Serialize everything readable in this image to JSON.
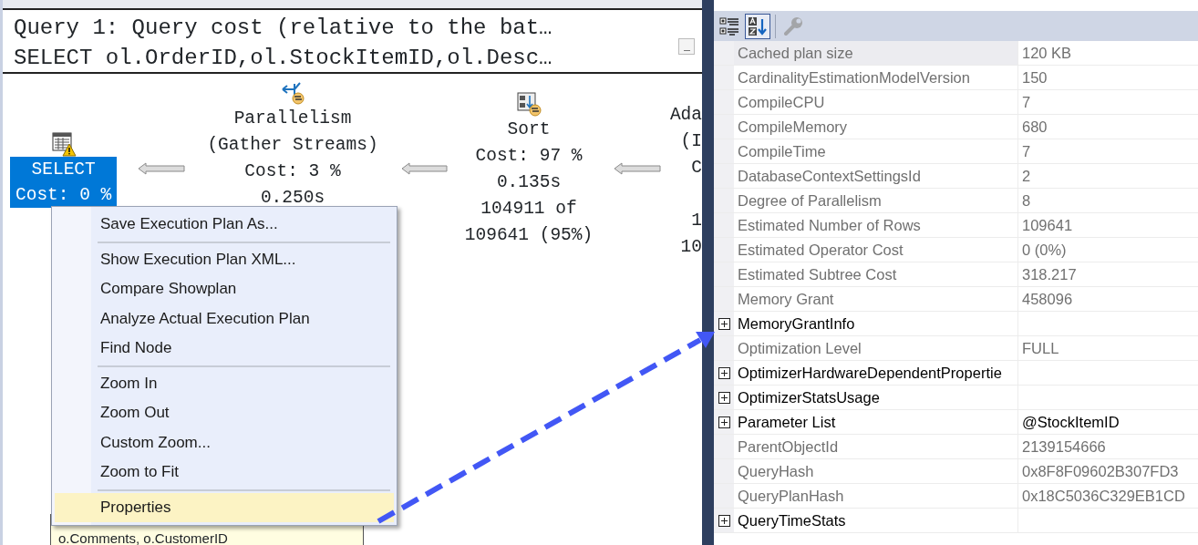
{
  "header": {
    "lines": [
      "Query 1: Query cost (relative to the bat…",
      "SELECT ol.OrderID,ol.StockItemID,ol.Desc…"
    ]
  },
  "plan": {
    "nodes": [
      {
        "kind": "select",
        "lines": [
          "SELECT",
          "Cost: 0 %"
        ],
        "selected": true,
        "warning": true
      },
      {
        "kind": "parallelism",
        "lines": [
          "Parallelism",
          "(Gather Streams)",
          "Cost: 3 %",
          "0.250s"
        ],
        "selected": false,
        "warning": false
      },
      {
        "kind": "sort",
        "lines": [
          "Sort",
          "Cost: 97 %",
          "0.135s",
          "104911 of",
          "109641 (95%)"
        ],
        "selected": false,
        "warning": false
      },
      {
        "kind": "partial",
        "lines": [
          "Ada",
          "(I",
          "C"
        ],
        "lower_lines": [
          "1",
          "10"
        ],
        "selected": false
      }
    ]
  },
  "tooltip": {
    "text": "o.Comments, o.CustomerID"
  },
  "context_menu": {
    "groups": [
      [
        {
          "label": "Save Execution Plan As...",
          "selected": false
        }
      ],
      [
        {
          "label": "Show Execution Plan XML...",
          "selected": false
        },
        {
          "label": "Compare Showplan",
          "selected": false
        },
        {
          "label": "Analyze Actual Execution Plan",
          "selected": false
        },
        {
          "label": "Find Node",
          "selected": false
        }
      ],
      [
        {
          "label": "Zoom In",
          "selected": false
        },
        {
          "label": "Zoom Out",
          "selected": false
        },
        {
          "label": "Custom Zoom...",
          "selected": false
        },
        {
          "label": "Zoom to Fit",
          "selected": false
        }
      ],
      [
        {
          "label": "Properties",
          "selected": true
        }
      ]
    ]
  },
  "properties": {
    "toolbar": [
      {
        "kind": "categorized",
        "selected": false,
        "disabled": false
      },
      {
        "kind": "alphabetical",
        "selected": true,
        "disabled": false
      },
      {
        "kind": "property-pages",
        "selected": false,
        "disabled": true
      }
    ],
    "rows": [
      {
        "kind": "value",
        "name": "Cached plan size",
        "value": "120 KB",
        "selected": true
      },
      {
        "kind": "value",
        "name": "CardinalityEstimationModelVersion",
        "value": "150",
        "selected": false
      },
      {
        "kind": "value",
        "name": "CompileCPU",
        "value": "7",
        "selected": false
      },
      {
        "kind": "value",
        "name": "CompileMemory",
        "value": "680",
        "selected": false
      },
      {
        "kind": "value",
        "name": "CompileTime",
        "value": "7",
        "selected": false
      },
      {
        "kind": "value",
        "name": "DatabaseContextSettingsId",
        "value": "2",
        "selected": false
      },
      {
        "kind": "value",
        "name": "Degree of Parallelism",
        "value": "8",
        "selected": false
      },
      {
        "kind": "value",
        "name": "Estimated Number of Rows",
        "value": "109641",
        "selected": false
      },
      {
        "kind": "value",
        "name": "Estimated Operator Cost",
        "value": "0 (0%)",
        "selected": false
      },
      {
        "kind": "value",
        "name": "Estimated Subtree Cost",
        "value": "318.217",
        "selected": false
      },
      {
        "kind": "value",
        "name": "Memory Grant",
        "value": "458096",
        "selected": false
      },
      {
        "kind": "group",
        "name": "MemoryGrantInfo",
        "selected": false
      },
      {
        "kind": "value",
        "name": "Optimization Level",
        "value": "FULL",
        "selected": false
      },
      {
        "kind": "group",
        "name": "OptimizerHardwareDependentPropertie",
        "selected": false
      },
      {
        "kind": "group",
        "name": "OptimizerStatsUsage",
        "selected": false
      },
      {
        "kind": "group",
        "name": "Parameter List",
        "value": "@StockItemID",
        "selected": false
      },
      {
        "kind": "value",
        "name": "ParentObjectId",
        "value": "2139154666",
        "selected": false
      },
      {
        "kind": "value",
        "name": "QueryHash",
        "value": "0x8F8F09602B307FD3",
        "selected": false
      },
      {
        "kind": "value",
        "name": "QueryPlanHash",
        "value": "0x18C5036C329EB1CD",
        "selected": false
      },
      {
        "kind": "group",
        "name": "QueryTimeStats",
        "selected": false
      }
    ]
  }
}
